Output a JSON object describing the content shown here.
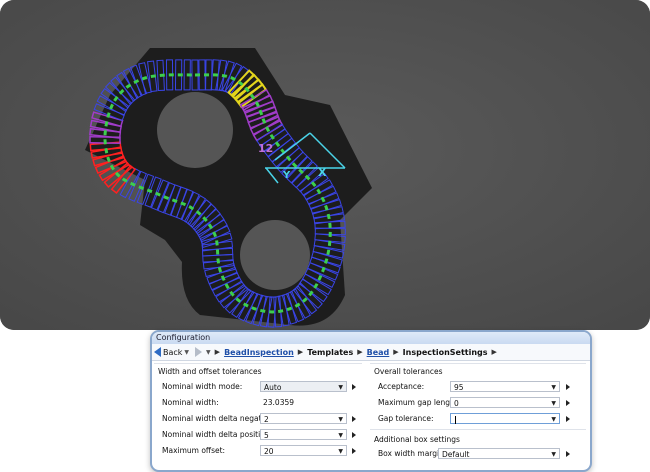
{
  "image_view": {
    "overlay_labels": {
      "count": "12",
      "x_axis": "X",
      "y_axis": "Y"
    },
    "colors": {
      "background": "#4f4f4f",
      "part": "#1e1e1e",
      "boxes": "#3a45e8",
      "centerline": "#3ccf4e",
      "defect": "#ff2020",
      "warning": "#e3d51c",
      "marginal": "#a03cc8",
      "axis": "#4ad3e8"
    }
  },
  "dialog": {
    "title": "Configuration",
    "nav": {
      "back_label": "Back",
      "breadcrumbs": [
        "BeadInspection",
        "Templates",
        "Bead",
        "InspectionSettings"
      ]
    },
    "left_group": {
      "title": "Width and offset tolerances",
      "rows": [
        {
          "label": "Nominal width mode:",
          "value": "Auto"
        },
        {
          "label": "Nominal width:",
          "value": "23.0359"
        },
        {
          "label": "Nominal width delta negative:",
          "value": "2"
        },
        {
          "label": "Nominal width delta positive:",
          "value": "5"
        },
        {
          "label": "Maximum offset:",
          "value": "20"
        }
      ]
    },
    "right_group": {
      "title": "Overall tolerances",
      "rows": [
        {
          "label": "Acceptance:",
          "value": "95"
        },
        {
          "label": "Maximum gap length:",
          "value": "0"
        },
        {
          "label": "Gap tolerance:",
          "value": ""
        }
      ],
      "sub_title": "Additional box settings",
      "sub_rows": [
        {
          "label": "Box width margin:",
          "value": "Default"
        }
      ]
    }
  }
}
